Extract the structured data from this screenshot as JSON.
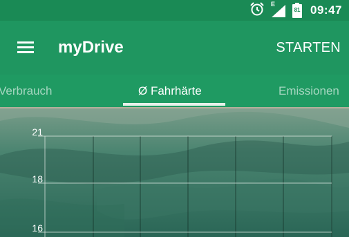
{
  "status_bar": {
    "network_label": "E",
    "battery_level": "81",
    "time": "09:47",
    "icons": [
      "alarm-icon",
      "signal-icon",
      "battery-icon"
    ]
  },
  "app_bar": {
    "title": "myDrive",
    "action_label": "STARTEN",
    "icons": [
      "menu-icon"
    ]
  },
  "tabs": [
    {
      "label": "Verbrauch",
      "selected": false
    },
    {
      "label": "Ø Fahrhärte",
      "selected": true
    },
    {
      "label": "Emissionen",
      "selected": false
    }
  ],
  "colors": {
    "status_bar": "#1a8a55",
    "app_bar": "#1f9660",
    "tab_bar": "#1f9a62",
    "tab_indicator": "#e8f1ea"
  },
  "chart_data": {
    "type": "line",
    "y_tick_labels": [
      "21",
      "18",
      "16"
    ],
    "grid": true
  }
}
